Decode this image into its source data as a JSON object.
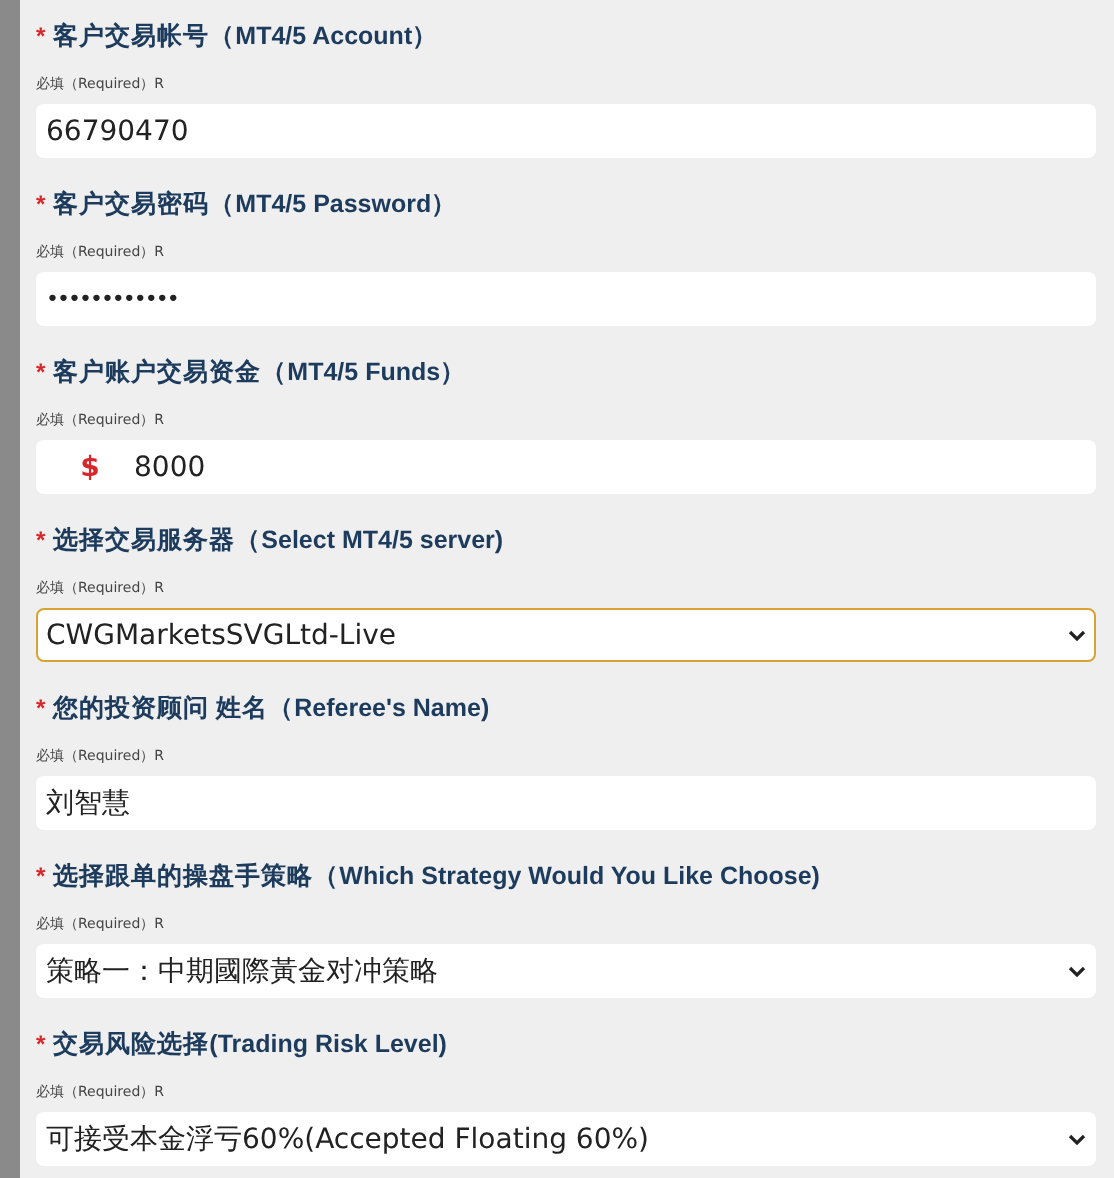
{
  "fields": [
    {
      "kind": "text",
      "marker": "*",
      "label": "客户交易帐号（MT4/5 Account）",
      "note": "必填（Required）R",
      "value": "66790470",
      "focused": false
    },
    {
      "kind": "password",
      "marker": "*",
      "label": "客户交易密码（MT4/5 Password）",
      "note": "必填（Required）R",
      "value": "••••••••••••",
      "focused": false
    },
    {
      "kind": "currency",
      "marker": "*",
      "label": "客户账户交易资金（MT4/5 Funds）",
      "note": "必填（Required）R",
      "prefix": "$",
      "value": "8000",
      "focused": false
    },
    {
      "kind": "select",
      "marker": "*",
      "label": "选择交易服务器（Select MT4/5 server)",
      "note": "必填（Required）R",
      "value": "CWGMarketsSVGLtd-Live",
      "focused": true
    },
    {
      "kind": "text",
      "marker": "*",
      "label": "您的投资顾问 姓名（Referee's Name)",
      "note": "必填（Required）R",
      "value": "刘智慧",
      "focused": false
    },
    {
      "kind": "select",
      "marker": "*",
      "label": "选择跟单的操盘手策略（Which Strategy Would You Like Choose)",
      "note": "必填（Required）R",
      "value": "策略一：中期國際黃金对冲策略",
      "focused": false
    },
    {
      "kind": "select",
      "marker": "*",
      "label": "交易风险选择(Trading Risk Level)",
      "note": "必填（Required）R",
      "value": "可接受本金浮亏60%(Accepted Floating 60%)",
      "focused": false
    }
  ]
}
